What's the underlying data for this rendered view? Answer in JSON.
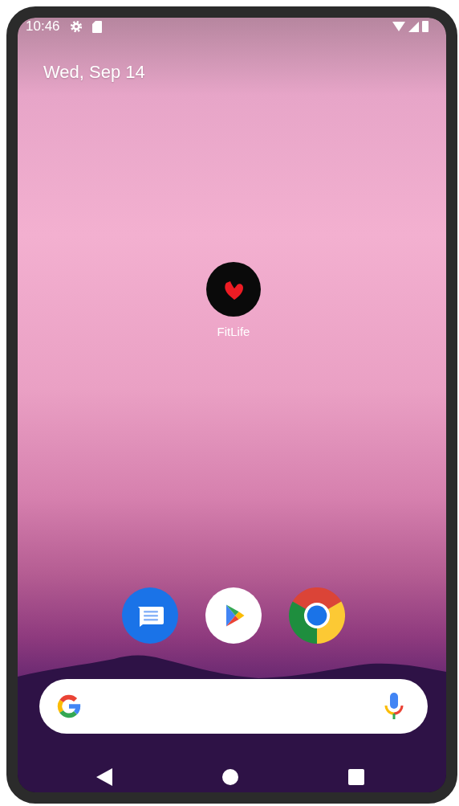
{
  "status_bar": {
    "time": "10:46"
  },
  "date": "Wed, Sep 14",
  "apps": [
    {
      "label": "FitLife"
    }
  ],
  "dock": [
    {
      "kind": "messages"
    },
    {
      "kind": "play"
    },
    {
      "kind": "chrome"
    }
  ]
}
